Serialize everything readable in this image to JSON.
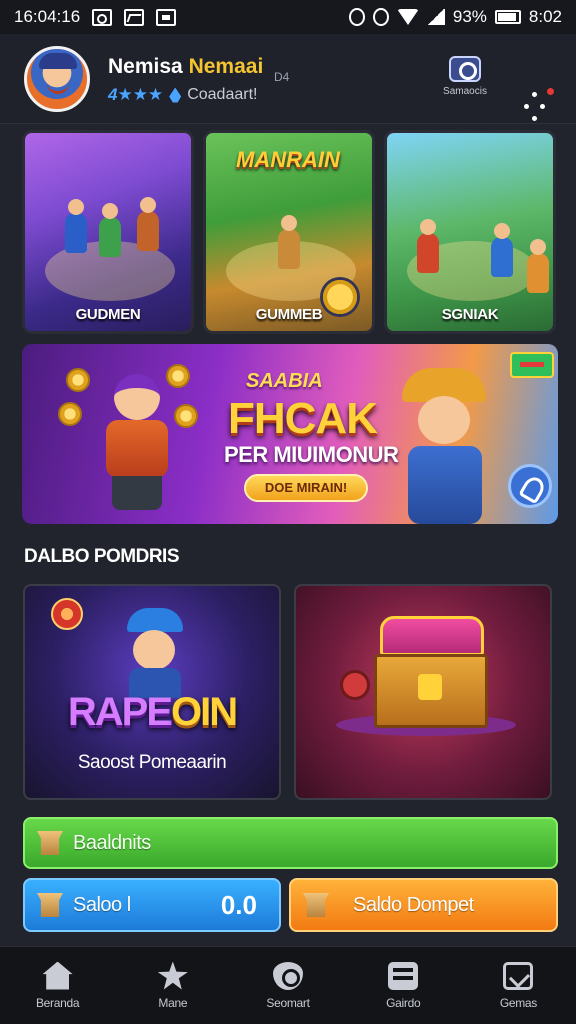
{
  "status_bar": {
    "time_left": "16:04:16",
    "battery_percent": "93%",
    "time_right": "8:02"
  },
  "profile": {
    "name_white": "Nemisa",
    "name_gold": "Nemaai",
    "tag": "D4",
    "level": "4★★★",
    "status": "Coadaart!",
    "camera_label": "Samaocis"
  },
  "game_cards": [
    {
      "title": "GUDMEN",
      "icon": "game-thumbnail"
    },
    {
      "title": "GUMMEB",
      "logo": "MANRAIN",
      "icon": "game-thumbnail"
    },
    {
      "title": "SGNIAK",
      "icon": "game-thumbnail"
    }
  ],
  "banner": {
    "subtitle": "SAABIA",
    "title": "FHCAK",
    "description": "PER MIUIMONUR",
    "cta": "DOE MIRAIN!"
  },
  "section": {
    "title": "DALBO POMDRIS"
  },
  "promos": [
    {
      "logo_part1": "RAPE",
      "logo_part2": "OIN",
      "label": "Saoost Pomeaarin"
    },
    {
      "label": ""
    }
  ],
  "buttons": {
    "green_label": "Baaldnits",
    "blue_label": "Saloo l",
    "blue_value": "0.0",
    "orange_label": "Saldo Dompet"
  },
  "nav": [
    {
      "label": "Beranda",
      "icon": "home-icon"
    },
    {
      "label": "Mane",
      "icon": "star-icon"
    },
    {
      "label": "Seomart",
      "icon": "shield-icon"
    },
    {
      "label": "Gairdo",
      "icon": "chat-icon"
    },
    {
      "label": "Gemas",
      "icon": "game-icon"
    }
  ],
  "colors": {
    "background": "#21242c",
    "accent_gold": "#f5c531",
    "green_button": "#3aa92c",
    "blue_button": "#1d7bd8",
    "orange_button": "#f27a12",
    "notification": "#e53935"
  }
}
